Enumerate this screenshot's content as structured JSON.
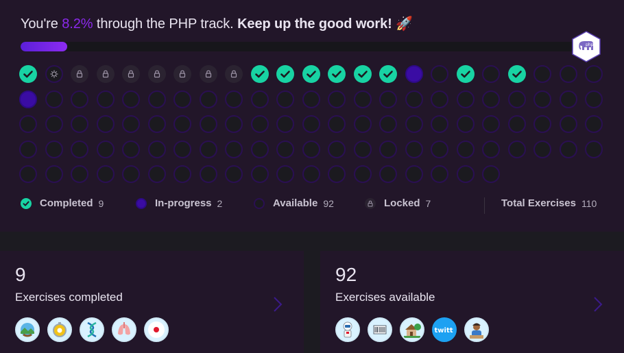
{
  "header": {
    "prefix": "You're ",
    "percent": "8.2%",
    "middle": " through the PHP track. ",
    "emphasis": "Keep up the good work!",
    "emoji": "🚀",
    "progress_fraction": 0.082
  },
  "track_icon": "php-elephant-icon",
  "colors": {
    "completed": "#18d3a3",
    "in_progress": "#3a0ca3",
    "accent": "#8b29ec",
    "panel": "#221629"
  },
  "exercise_grid": {
    "rows": [
      [
        "completed",
        "unlocked",
        "locked",
        "locked",
        "locked",
        "locked",
        "locked",
        "locked",
        "locked",
        "completed",
        "completed",
        "completed",
        "completed",
        "completed",
        "completed",
        "in-progress",
        "available",
        "completed",
        "available",
        "completed",
        "available",
        "available",
        "available"
      ],
      [
        "in-progress",
        "available",
        "available",
        "available",
        "available",
        "available",
        "available",
        "available",
        "available",
        "available",
        "available",
        "available",
        "available",
        "available",
        "available",
        "available",
        "available",
        "available",
        "available",
        "available",
        "available",
        "available",
        "available"
      ],
      [
        "available",
        "available",
        "available",
        "available",
        "available",
        "available",
        "available",
        "available",
        "available",
        "available",
        "available",
        "available",
        "available",
        "available",
        "available",
        "available",
        "available",
        "available",
        "available",
        "available",
        "available",
        "available",
        "available"
      ],
      [
        "available",
        "available",
        "available",
        "available",
        "available",
        "available",
        "available",
        "available",
        "available",
        "available",
        "available",
        "available",
        "available",
        "available",
        "available",
        "available",
        "available",
        "available",
        "available",
        "available",
        "available",
        "available",
        "available"
      ],
      [
        "available",
        "available",
        "available",
        "available",
        "available",
        "available",
        "available",
        "available",
        "available",
        "available",
        "available",
        "available",
        "available",
        "available",
        "available",
        "available",
        "available",
        "available",
        "available"
      ]
    ]
  },
  "legend": {
    "completed_label": "Completed",
    "completed_count": "9",
    "in_progress_label": "In-progress",
    "in_progress_count": "2",
    "available_label": "Available",
    "available_count": "92",
    "locked_label": "Locked",
    "locked_count": "7",
    "total_label": "Total Exercises",
    "total_count": "110"
  },
  "cards": {
    "completed": {
      "number": "9",
      "label": "Exercises completed",
      "icons": [
        "globe-landscape-icon",
        "gear-clock-icon",
        "dna-icon",
        "lungs-icon",
        "record-dot-icon"
      ]
    },
    "available": {
      "number": "92",
      "label": "Exercises available",
      "icons": [
        "astronaut-icon",
        "barcode-icon",
        "house-icon",
        "twitt-logo-icon",
        "librarian-icon"
      ]
    }
  }
}
